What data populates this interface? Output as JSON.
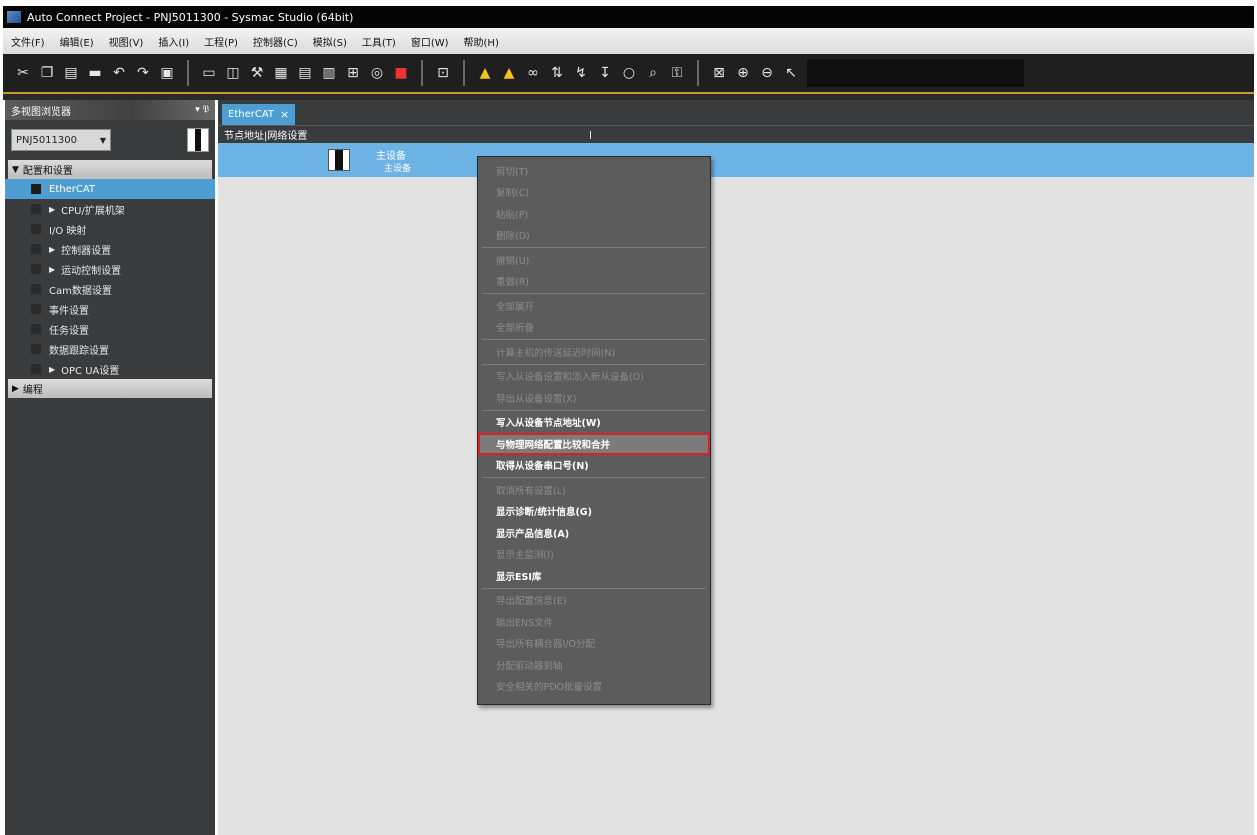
{
  "window": {
    "title": "Auto Connect Project - PNJ5011300 - Sysmac Studio (64bit)"
  },
  "menubar": [
    "文件(F)",
    "编辑(E)",
    "视图(V)",
    "插入(I)",
    "工程(P)",
    "控制器(C)",
    "模拟(S)",
    "工具(T)",
    "窗口(W)",
    "帮助(H)"
  ],
  "toolbar": {
    "groups": [
      [
        "cut-icon",
        "copy-icon",
        "paste-icon",
        "delete-icon",
        "undo-icon",
        "redo-icon",
        "save-icon"
      ],
      [
        "window-icon",
        "layout-icon",
        "wrench-icon",
        "grid-icon",
        "table-icon",
        "build-icon",
        "network-icon",
        "binoculars-icon",
        "stop-icon"
      ],
      [
        "monitor-icon"
      ],
      [
        "warning-icon",
        "warning-off-icon",
        "link-icon",
        "transfer-icon",
        "online-icon",
        "offline-icon",
        "circle-icon",
        "search-icon",
        "key-icon"
      ],
      [
        "fit-icon",
        "zoom-in-icon",
        "zoom-out-icon",
        "pointer-icon"
      ]
    ]
  },
  "left_panel": {
    "title": "多视图浏览器",
    "pin": "▾ 𝔓",
    "device": "PNJ5011300",
    "config_group": "配置和设置",
    "items": [
      {
        "label": "EtherCAT",
        "expandable": false,
        "selected": true
      },
      {
        "label": "CPU/扩展机架",
        "expandable": true,
        "selected": false
      },
      {
        "label": "I/O 映射",
        "expandable": false,
        "selected": false
      },
      {
        "label": "控制器设置",
        "expandable": true,
        "selected": false
      },
      {
        "label": "运动控制设置",
        "expandable": true,
        "selected": false
      },
      {
        "label": "Cam数据设置",
        "expandable": false,
        "selected": false
      },
      {
        "label": "事件设置",
        "expandable": false,
        "selected": false
      },
      {
        "label": "任务设置",
        "expandable": false,
        "selected": false
      },
      {
        "label": "数据跟踪设置",
        "expandable": false,
        "selected": false
      },
      {
        "label": "OPC UA设置",
        "expandable": true,
        "selected": false
      }
    ],
    "program_group": "编程"
  },
  "main": {
    "tab": {
      "label": "EtherCAT",
      "close": "×"
    },
    "column_header": "节点地址|网络设置",
    "master": {
      "name": "主设备",
      "sub": "主设备"
    }
  },
  "context_menu": {
    "items": [
      {
        "type": "item",
        "label": "剪切(T)",
        "enabled": false
      },
      {
        "type": "item",
        "label": "复制(C)",
        "enabled": false
      },
      {
        "type": "item",
        "label": "粘贴(P)",
        "enabled": false
      },
      {
        "type": "item",
        "label": "删除(D)",
        "enabled": false
      },
      {
        "type": "sep"
      },
      {
        "type": "item",
        "label": "撤销(U)",
        "enabled": false
      },
      {
        "type": "item",
        "label": "重做(R)",
        "enabled": false
      },
      {
        "type": "sep"
      },
      {
        "type": "item",
        "label": "全部展开",
        "enabled": false
      },
      {
        "type": "item",
        "label": "全部折叠",
        "enabled": false
      },
      {
        "type": "sep"
      },
      {
        "type": "item",
        "label": "计算主机的传送延迟时间(N)",
        "enabled": false
      },
      {
        "type": "sep"
      },
      {
        "type": "item",
        "label": "写入从设备设置和添入新从设备(O)",
        "enabled": false
      },
      {
        "type": "item",
        "label": "导出从设备设置(X)",
        "enabled": false
      },
      {
        "type": "sep"
      },
      {
        "type": "item",
        "label": "写入从设备节点地址(W)",
        "enabled": true
      },
      {
        "type": "item",
        "label": "与物理网络配置比较和合并",
        "enabled": true,
        "highlighted": true
      },
      {
        "type": "item",
        "label": "取得从设备串口号(N)",
        "enabled": true
      },
      {
        "type": "sep"
      },
      {
        "type": "item",
        "label": "取消所有设置(L)",
        "enabled": false
      },
      {
        "type": "item",
        "label": "显示诊断/统计信息(G)",
        "enabled": true
      },
      {
        "type": "item",
        "label": "显示产品信息(A)",
        "enabled": true
      },
      {
        "type": "item",
        "label": "显示主监测(I)",
        "enabled": false
      },
      {
        "type": "item",
        "label": "显示ESI库",
        "enabled": true
      },
      {
        "type": "sep"
      },
      {
        "type": "item",
        "label": "导出配置信息(E)",
        "enabled": false
      },
      {
        "type": "item",
        "label": "输出ENS文件",
        "enabled": false
      },
      {
        "type": "item",
        "label": "导出所有耦合器I/O分配",
        "enabled": false
      },
      {
        "type": "item",
        "label": "分配驱动器到轴",
        "enabled": false
      },
      {
        "type": "item",
        "label": "安全相关的PDO批量设置",
        "enabled": false
      }
    ]
  }
}
